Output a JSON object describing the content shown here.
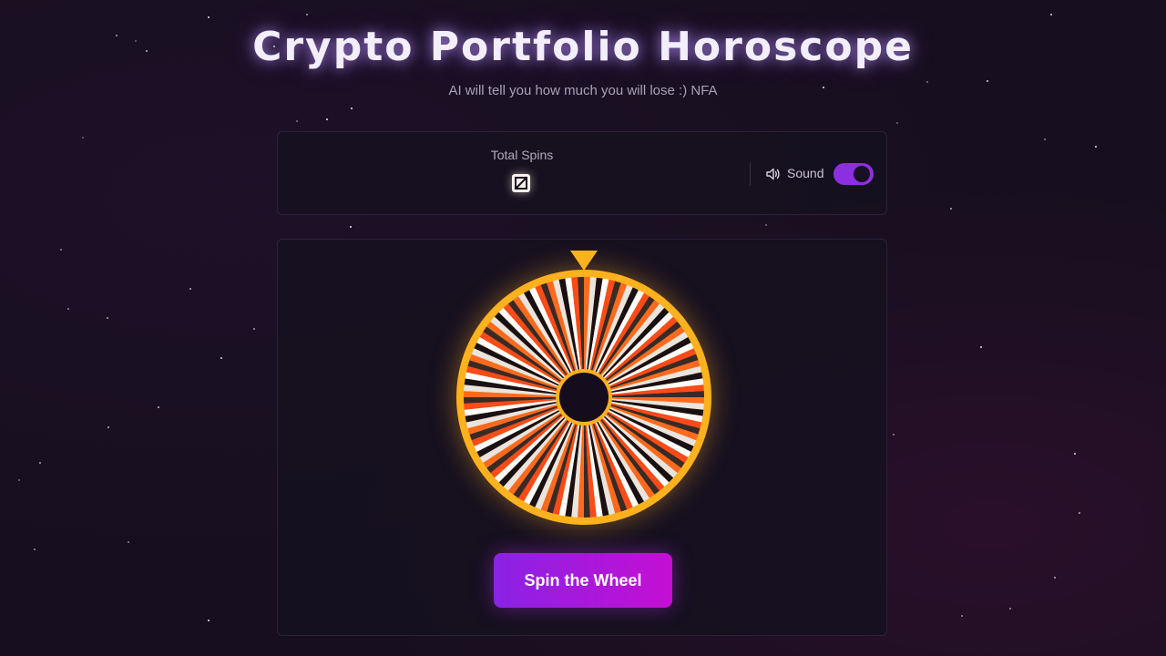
{
  "header": {
    "title": "Crypto Portfolio Horoscope",
    "subtitle": "AI will tell you how much you will lose :) NFA"
  },
  "stats": {
    "total_spins_label": "Total Spins",
    "total_spins_value": "",
    "total_spins_icon": "broken-glyph-icon"
  },
  "sound": {
    "label": "Sound",
    "enabled": true,
    "icon": "speaker-icon"
  },
  "wheel": {
    "pointer_icon": "pointer-triangle-icon",
    "segment_count": 120,
    "segment_colors": [
      "#ff6a1f",
      "#e9e4de",
      "#1a1014",
      "#ffffff",
      "#ff4a1a",
      "#3a2a26"
    ],
    "rim_color": "#ffb21e",
    "hub_color": "#150d1e"
  },
  "actions": {
    "spin_label": "Spin the Wheel"
  },
  "colors": {
    "background": "#170f1f",
    "panel": "#161020",
    "accent_purple": "#8b2fe0",
    "accent_magenta": "#c40fd3",
    "gold": "#ffb21e"
  }
}
